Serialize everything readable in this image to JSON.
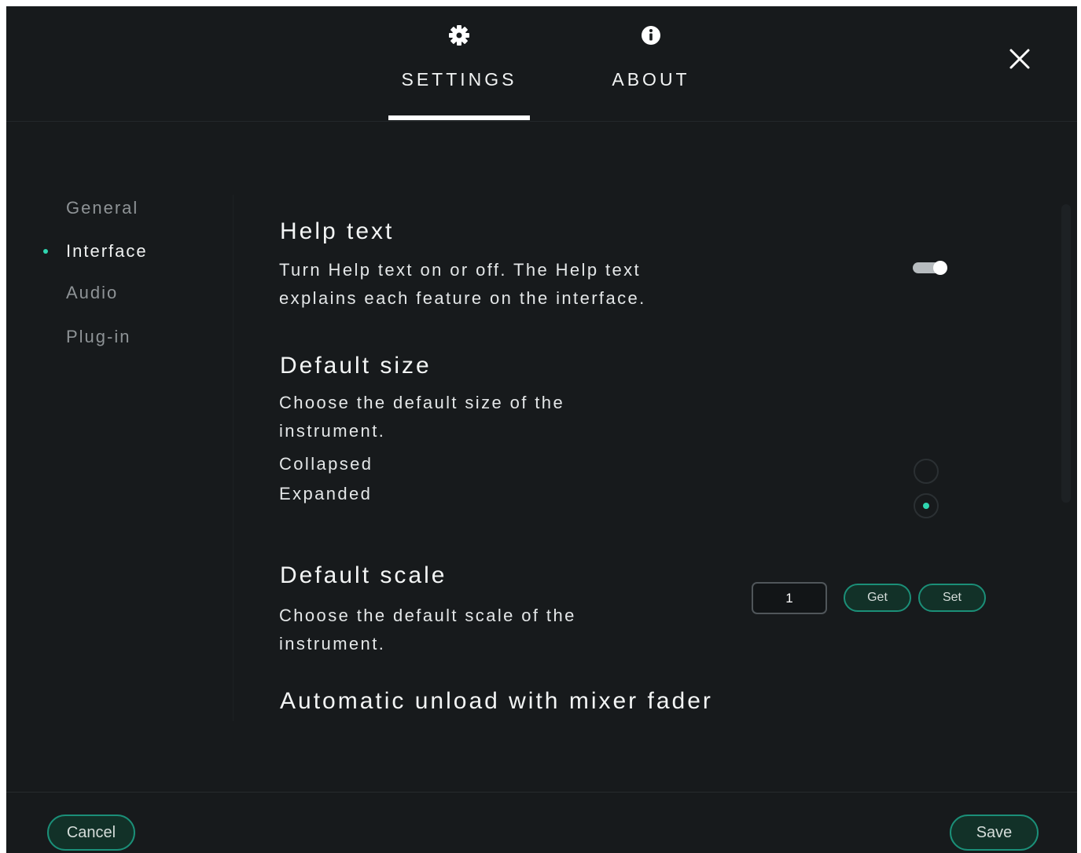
{
  "tabs": [
    {
      "label": "SETTINGS",
      "icon": "gear-icon",
      "active": true
    },
    {
      "label": "ABOUT",
      "icon": "info-icon",
      "active": false
    }
  ],
  "close_icon": "close-icon",
  "sidebar": {
    "items": [
      {
        "label": "General",
        "active": false
      },
      {
        "label": "Interface",
        "active": true
      },
      {
        "label": "Audio",
        "active": false
      },
      {
        "label": "Plug-in",
        "active": false
      }
    ]
  },
  "sections": {
    "help_text": {
      "title": "Help text",
      "desc_line1": "Turn Help text on or off. The Help text",
      "desc_line2": "explains each feature on the interface.",
      "enabled": true
    },
    "default_size": {
      "title": "Default size",
      "desc_line1": "Choose the default size of the",
      "desc_line2": "instrument.",
      "options": [
        {
          "label": "Collapsed",
          "selected": false
        },
        {
          "label": "Expanded",
          "selected": true
        }
      ]
    },
    "default_scale": {
      "title": "Default scale",
      "desc_line1": "Choose the default scale of the",
      "desc_line2": "instrument.",
      "value": "1",
      "get_label": "Get",
      "set_label": "Set"
    },
    "auto_unload": {
      "title": "Automatic unload with mixer fader"
    }
  },
  "footer": {
    "cancel_label": "Cancel",
    "save_label": "Save"
  },
  "colors": {
    "background": "#171a1c",
    "accent": "#2fd6b0",
    "button_border": "#1b8f78",
    "button_fill": "#123128"
  }
}
